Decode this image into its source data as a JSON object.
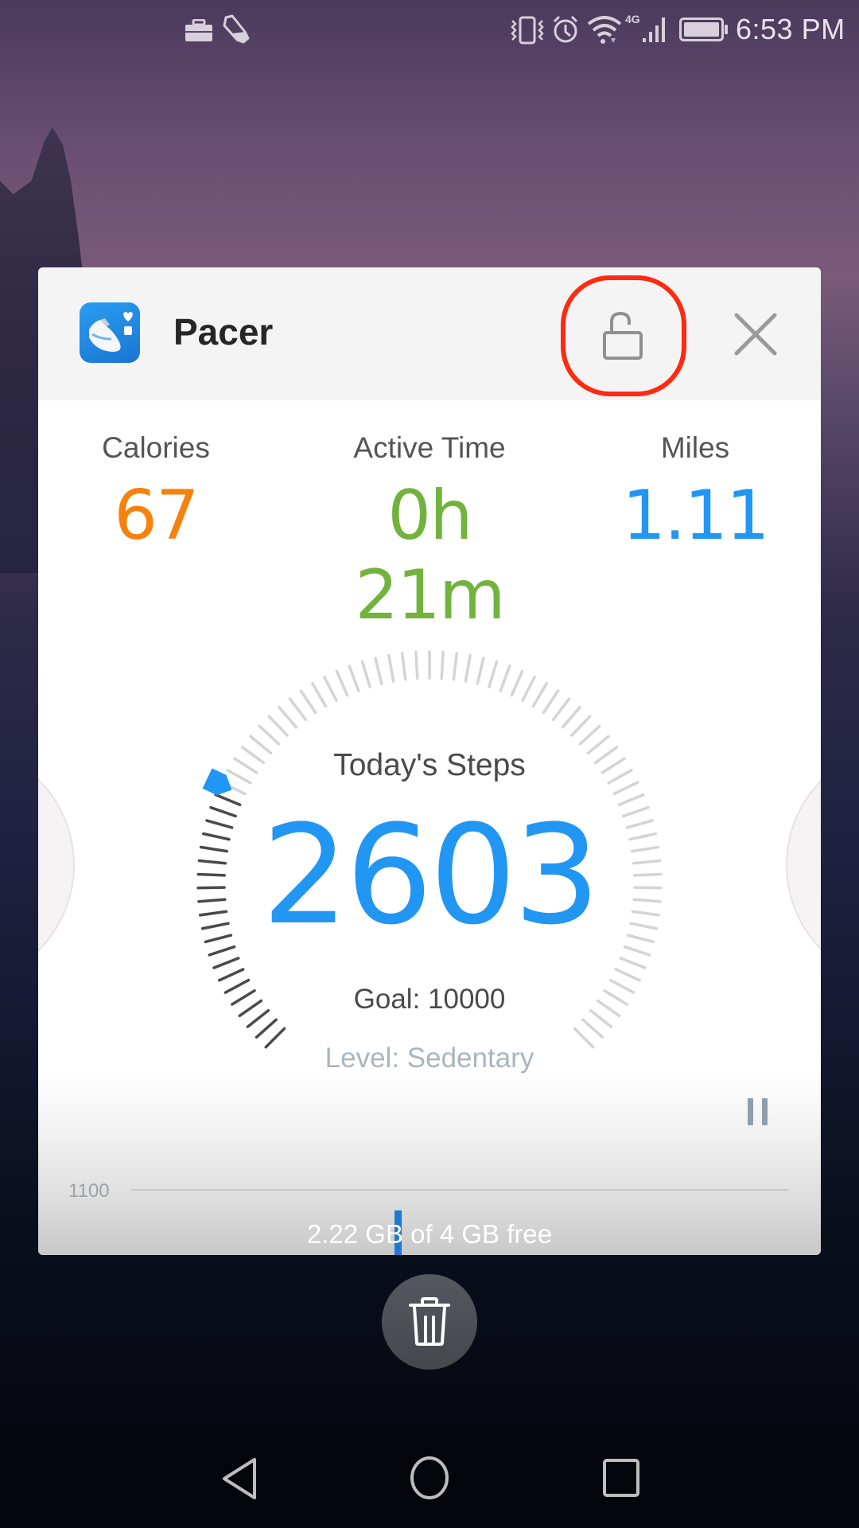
{
  "status_bar": {
    "time": "6:53 PM",
    "left_icons": [
      "briefcase-icon",
      "shoe-icon"
    ],
    "right_icons": [
      "vibrate-icon",
      "alarm-icon",
      "wifi-icon",
      "4g-signal-icon",
      "battery-icon"
    ],
    "network_label": "4G"
  },
  "recent_card": {
    "app_name": "Pacer",
    "lock_button": "unlock-icon",
    "close_button": "close-icon",
    "highlight_color": "#ff2a12"
  },
  "stats": [
    {
      "label": "Calories",
      "value": "67",
      "color": "#f5820d"
    },
    {
      "label": "Active Time",
      "value": "0h 21m",
      "color": "#72b33e"
    },
    {
      "label": "Miles",
      "value": "1.11",
      "color": "#2196f3"
    }
  ],
  "steps": {
    "label": "Today's Steps",
    "value": "2603",
    "goal_label": "Goal: 10000",
    "level_label": "Level: Sedentary",
    "progress_fraction": 0.2603,
    "accent_color": "#2196f3"
  },
  "chart": {
    "axis_label": "1100"
  },
  "memory": {
    "text": "2.22 GB of 4 GB free"
  },
  "controls": {
    "trash_button": "trash-icon"
  },
  "navigation": {
    "back": "back-icon",
    "home": "home-icon",
    "recents": "recents-icon"
  }
}
